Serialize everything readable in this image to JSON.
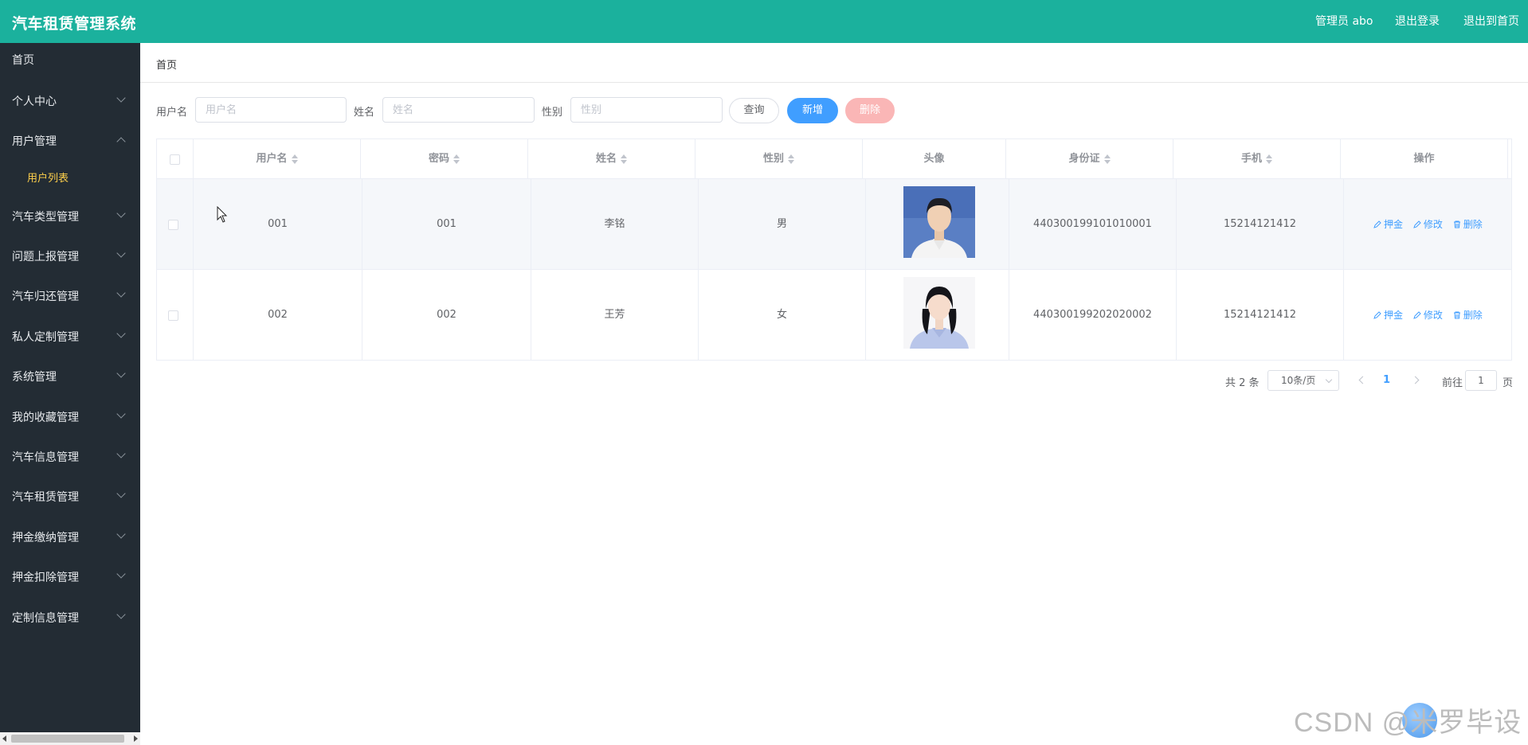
{
  "app": {
    "title": "汽车租赁管理系统"
  },
  "header": {
    "links": [
      "管理员 abo",
      "退出登录",
      "退出到首页"
    ]
  },
  "sidebar": {
    "items": [
      {
        "label": "首页"
      },
      {
        "label": "个人中心"
      },
      {
        "label": "用户管理",
        "expanded": true,
        "children": [
          {
            "label": "用户列表",
            "active": true
          }
        ]
      },
      {
        "label": "汽车类型管理"
      },
      {
        "label": "问题上报管理"
      },
      {
        "label": "汽车归还管理"
      },
      {
        "label": "私人定制管理"
      },
      {
        "label": "系统管理"
      },
      {
        "label": "我的收藏管理"
      },
      {
        "label": "汽车信息管理"
      },
      {
        "label": "汽车租赁管理"
      },
      {
        "label": "押金缴纳管理"
      },
      {
        "label": "押金扣除管理"
      },
      {
        "label": "定制信息管理"
      }
    ]
  },
  "breadcrumb": "首页",
  "search": {
    "username_label": "用户名",
    "username_placeholder": "用户名",
    "name_label": "姓名",
    "name_placeholder": "姓名",
    "gender_label": "性别",
    "gender_placeholder": "性别",
    "query_btn": "查询",
    "add_btn": "新增",
    "delete_btn": "删除"
  },
  "table": {
    "columns": [
      "用户名",
      "密码",
      "姓名",
      "性别",
      "头像",
      "身份证",
      "手机",
      "操作"
    ],
    "rows": [
      {
        "username": "001",
        "password": "001",
        "name": "李铭",
        "gender": "男",
        "id_card": "440300199101010001",
        "phone": "15214121412"
      },
      {
        "username": "002",
        "password": "002",
        "name": "王芳",
        "gender": "女",
        "id_card": "440300199202020002",
        "phone": "15214121412"
      }
    ],
    "actions": [
      "押金",
      "修改",
      "删除"
    ]
  },
  "pagination": {
    "total": "共 2 条",
    "page_size": "10条/页",
    "current_page": "1",
    "goto_label": "前往",
    "goto_value": "1",
    "goto_suffix": "页"
  },
  "watermark": "CSDN @米罗毕设",
  "colors": {
    "header": "#1bb19d",
    "sidebar": "#232c34",
    "primary": "#409eff",
    "danger_disabled": "#fab6b6",
    "active_submenu": "#ffd04b"
  }
}
